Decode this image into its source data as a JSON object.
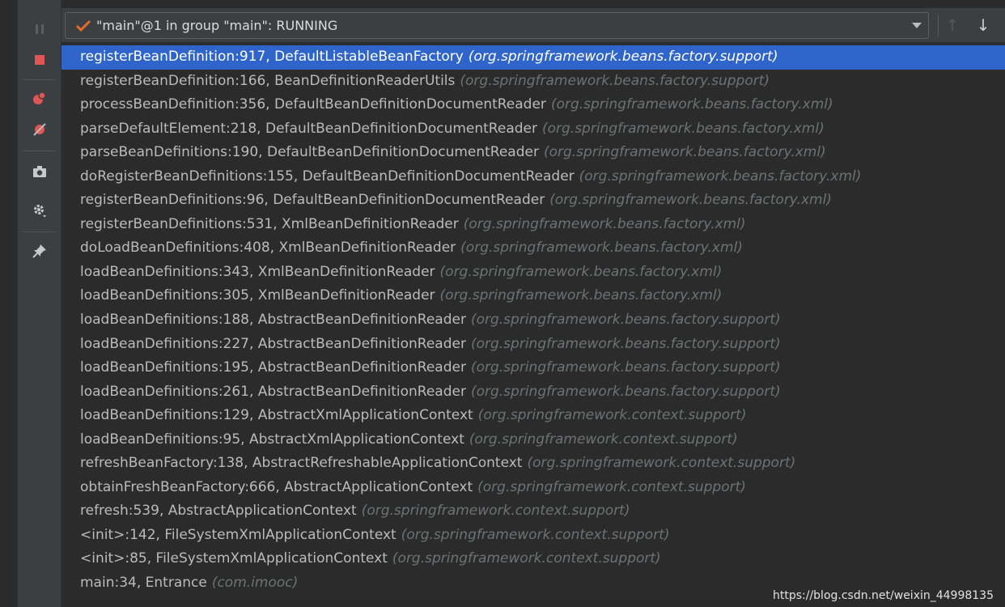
{
  "thread": {
    "label": "\"main\"@1 in group \"main\": RUNNING",
    "status_color": "#e8692c"
  },
  "toolbar_icons": [
    "pause-icon",
    "stop-icon",
    "view-breakpoints-icon",
    "mute-breakpoints-icon",
    "camera-icon",
    "settings-icon",
    "pin-icon"
  ],
  "frames": [
    {
      "method": "registerBeanDefinition:917, DefaultListableBeanFactory",
      "pkg": "(org.springframework.beans.factory.support)"
    },
    {
      "method": "registerBeanDefinition:166, BeanDefinitionReaderUtils",
      "pkg": "(org.springframework.beans.factory.support)"
    },
    {
      "method": "processBeanDefinition:356, DefaultBeanDefinitionDocumentReader",
      "pkg": "(org.springframework.beans.factory.xml)"
    },
    {
      "method": "parseDefaultElement:218, DefaultBeanDefinitionDocumentReader",
      "pkg": "(org.springframework.beans.factory.xml)"
    },
    {
      "method": "parseBeanDefinitions:190, DefaultBeanDefinitionDocumentReader",
      "pkg": "(org.springframework.beans.factory.xml)"
    },
    {
      "method": "doRegisterBeanDefinitions:155, DefaultBeanDefinitionDocumentReader",
      "pkg": "(org.springframework.beans.factory.xml)"
    },
    {
      "method": "registerBeanDefinitions:96, DefaultBeanDefinitionDocumentReader",
      "pkg": "(org.springframework.beans.factory.xml)"
    },
    {
      "method": "registerBeanDefinitions:531, XmlBeanDefinitionReader",
      "pkg": "(org.springframework.beans.factory.xml)"
    },
    {
      "method": "doLoadBeanDefinitions:408, XmlBeanDefinitionReader",
      "pkg": "(org.springframework.beans.factory.xml)"
    },
    {
      "method": "loadBeanDefinitions:343, XmlBeanDefinitionReader",
      "pkg": "(org.springframework.beans.factory.xml)"
    },
    {
      "method": "loadBeanDefinitions:305, XmlBeanDefinitionReader",
      "pkg": "(org.springframework.beans.factory.xml)"
    },
    {
      "method": "loadBeanDefinitions:188, AbstractBeanDefinitionReader",
      "pkg": "(org.springframework.beans.factory.support)"
    },
    {
      "method": "loadBeanDefinitions:227, AbstractBeanDefinitionReader",
      "pkg": "(org.springframework.beans.factory.support)"
    },
    {
      "method": "loadBeanDefinitions:195, AbstractBeanDefinitionReader",
      "pkg": "(org.springframework.beans.factory.support)"
    },
    {
      "method": "loadBeanDefinitions:261, AbstractBeanDefinitionReader",
      "pkg": "(org.springframework.beans.factory.support)"
    },
    {
      "method": "loadBeanDefinitions:129, AbstractXmlApplicationContext",
      "pkg": "(org.springframework.context.support)"
    },
    {
      "method": "loadBeanDefinitions:95, AbstractXmlApplicationContext",
      "pkg": "(org.springframework.context.support)"
    },
    {
      "method": "refreshBeanFactory:138, AbstractRefreshableApplicationContext",
      "pkg": "(org.springframework.context.support)"
    },
    {
      "method": "obtainFreshBeanFactory:666, AbstractApplicationContext",
      "pkg": "(org.springframework.context.support)"
    },
    {
      "method": "refresh:539, AbstractApplicationContext",
      "pkg": "(org.springframework.context.support)"
    },
    {
      "method": "<init>:142, FileSystemXmlApplicationContext",
      "pkg": "(org.springframework.context.support)"
    },
    {
      "method": "<init>:85, FileSystemXmlApplicationContext",
      "pkg": "(org.springframework.context.support)"
    },
    {
      "method": "main:34, Entrance",
      "pkg": "(com.imooc)"
    }
  ],
  "selected_index": 0,
  "watermark": "https://blog.csdn.net/weixin_44998135",
  "colors": {
    "selection": "#2f65ca",
    "stop": "#e05555",
    "breakpoint": "#e05555",
    "check": "#e8692c"
  }
}
